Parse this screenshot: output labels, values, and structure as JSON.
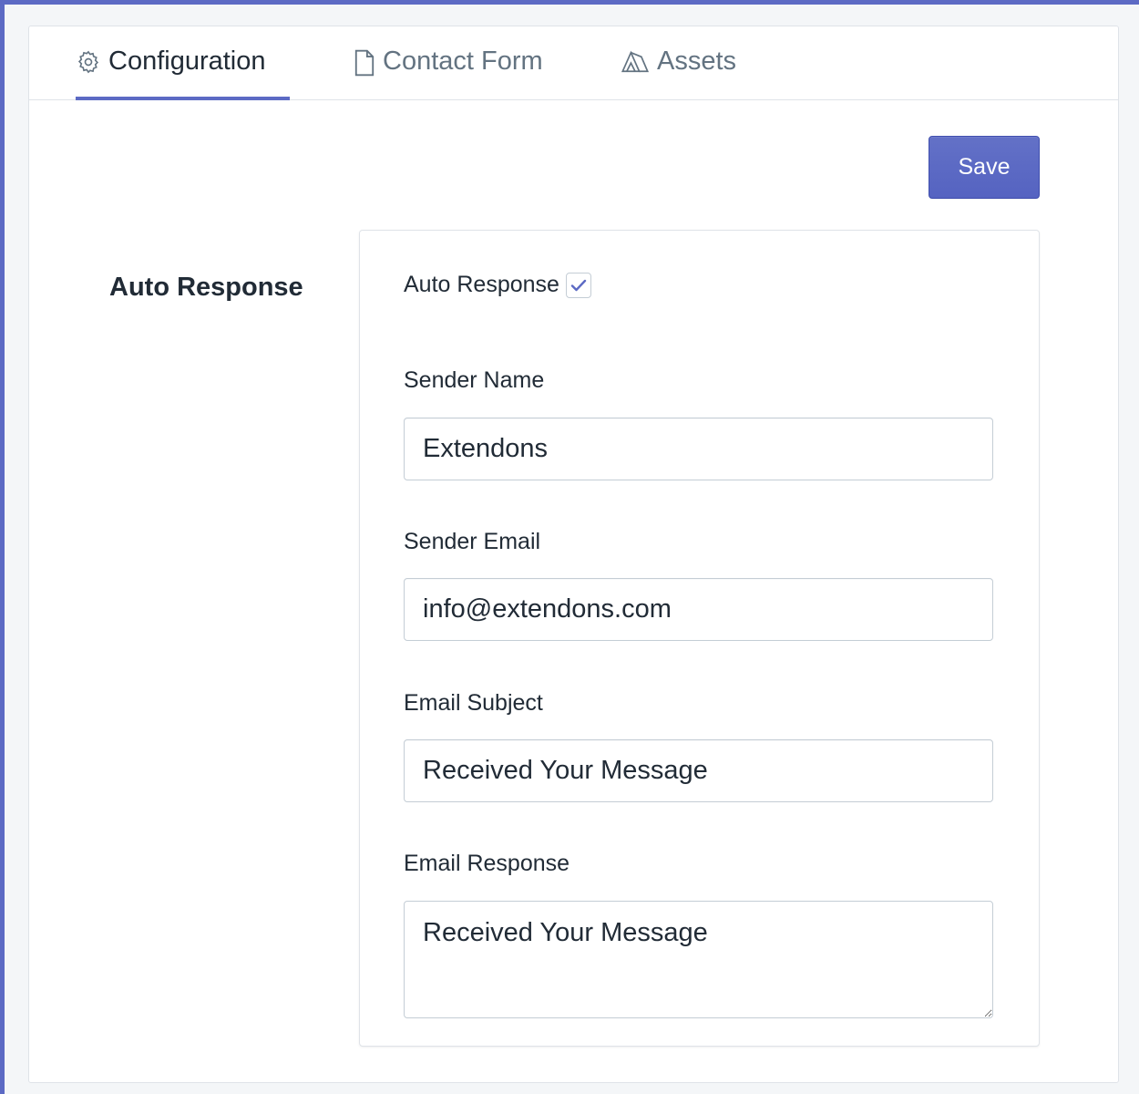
{
  "tabs": [
    {
      "label": "Configuration",
      "icon": "gear-icon",
      "active": true
    },
    {
      "label": "Contact Form",
      "icon": "document-icon",
      "active": false
    },
    {
      "label": "Assets",
      "icon": "assets-icon",
      "active": false
    }
  ],
  "toolbar": {
    "save_label": "Save"
  },
  "section": {
    "title": "Auto Response"
  },
  "form": {
    "auto_response": {
      "label": "Auto Response",
      "checked": true
    },
    "sender_name": {
      "label": "Sender Name",
      "value": "Extendons"
    },
    "sender_email": {
      "label": "Sender Email",
      "value": "info@extendons.com"
    },
    "email_subject": {
      "label": "Email Subject",
      "value": "Received Your Message"
    },
    "email_response": {
      "label": "Email Response",
      "value": "Received Your Message"
    }
  },
  "colors": {
    "accent": "#5c6ac4",
    "border": "#c4cdd5",
    "text": "#212b36",
    "muted": "#637381"
  }
}
